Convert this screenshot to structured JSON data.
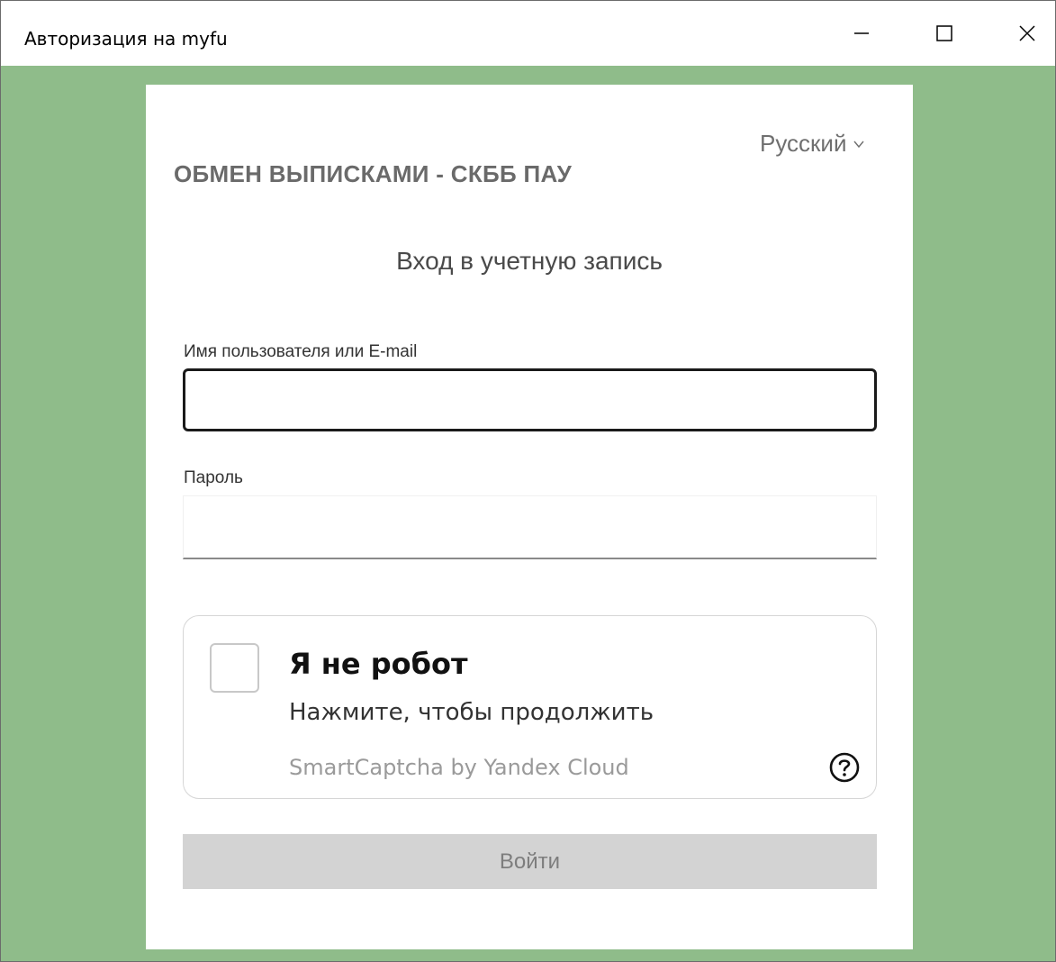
{
  "window": {
    "title": "Авторизация на myfu",
    "minimize_icon": "minimize-icon",
    "maximize_icon": "maximize-icon",
    "close_icon": "close-icon"
  },
  "colors": {
    "background": "#8fbc8a",
    "card": "#ffffff",
    "button_disabled": "#d3d3d3"
  },
  "header": {
    "language": "Русский",
    "language_icon": "chevron-down-icon",
    "app_title": "ОБМЕН ВЫПИСКАМИ - СКББ ПАУ"
  },
  "form": {
    "heading": "Вход в учетную запись",
    "username_label": "Имя пользователя или E-mail",
    "username_value": "",
    "password_label": "Пароль",
    "password_value": ""
  },
  "captcha": {
    "title": "Я не робот",
    "subtitle": "Нажмите, чтобы продолжить",
    "brand": "SmartCaptcha by Yandex Cloud",
    "help_icon": "question-circle-icon"
  },
  "submit": {
    "label": "Войти"
  }
}
